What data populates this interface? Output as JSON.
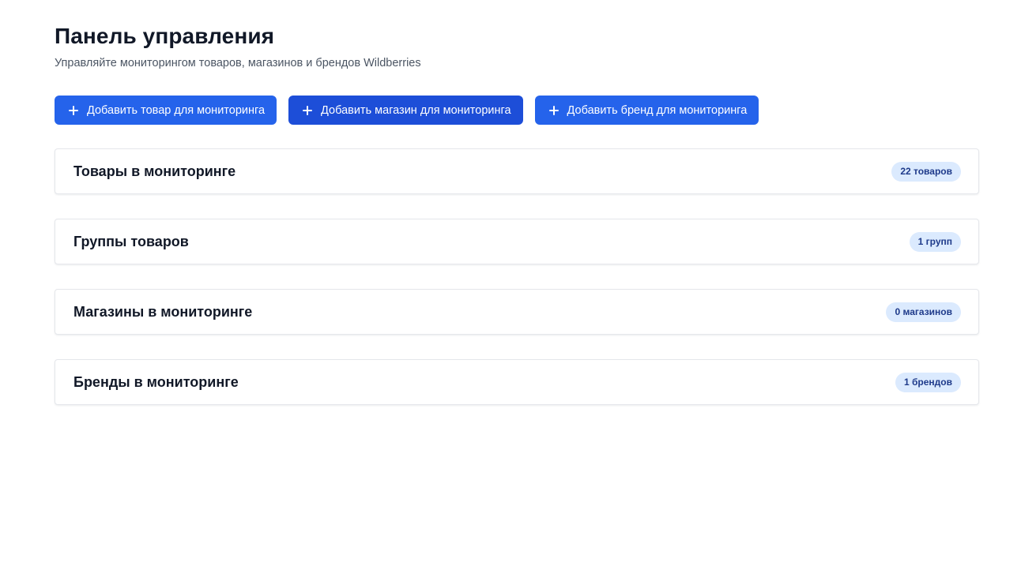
{
  "header": {
    "title": "Панель управления",
    "subtitle": "Управляйте мониторингом товаров, магазинов и брендов Wildberries"
  },
  "actions": [
    {
      "label": "Добавить товар для мониторинга",
      "icon": "plus-icon"
    },
    {
      "label": "Добавить магазин для мониторинга",
      "icon": "plus-icon"
    },
    {
      "label": "Добавить бренд для мониторинга",
      "icon": "plus-icon"
    }
  ],
  "sections": [
    {
      "title": "Товары в мониторинге",
      "badge": "22 товаров"
    },
    {
      "title": "Группы товаров",
      "badge": "1 групп"
    },
    {
      "title": "Магазины в мониторинге",
      "badge": "0 магазинов"
    },
    {
      "title": "Бренды в мониторинге",
      "badge": "1 брендов"
    }
  ],
  "colors": {
    "primary": "#2563eb",
    "primary_active": "#1d4ed8",
    "badge_bg": "#dbeafe",
    "badge_text": "#1e3a8a"
  }
}
